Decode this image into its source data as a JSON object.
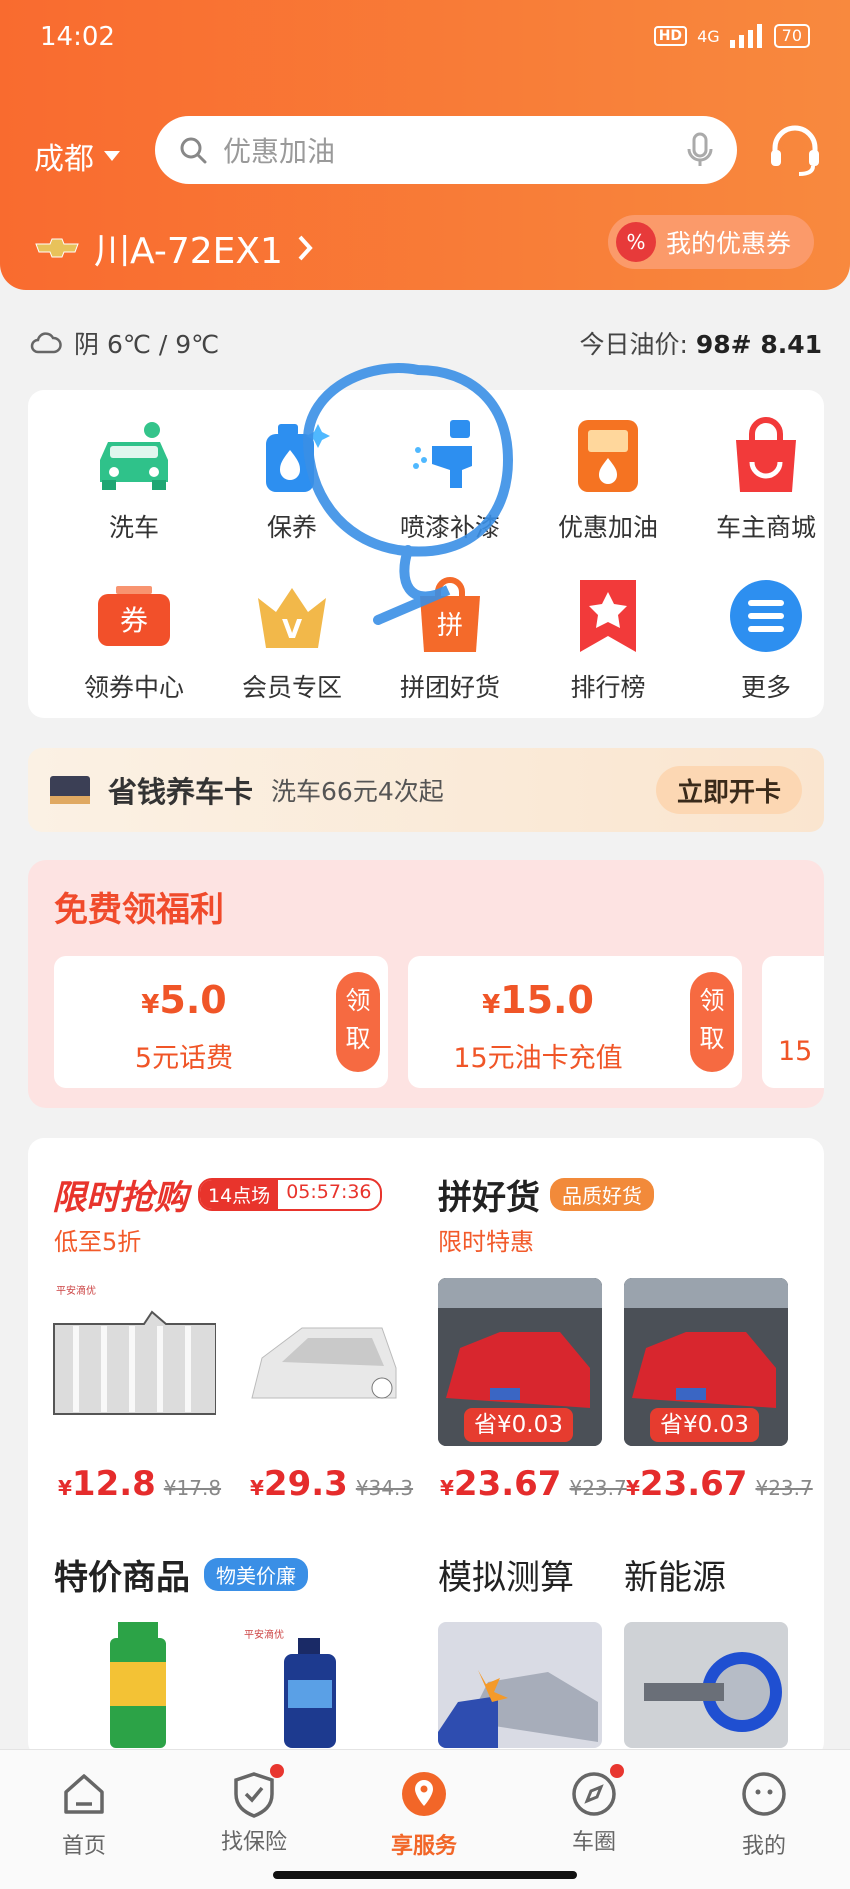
{
  "status_bar": {
    "time": "14:02",
    "network": "4G",
    "hd": "HD",
    "battery": "70"
  },
  "header": {
    "city": "成都",
    "search_placeholder": "优惠加油",
    "plate": "川A-72EX1",
    "coupon_label": "我的优惠券"
  },
  "weather": {
    "text": "阴 6℃ / 9℃",
    "oil_label": "今日油价:",
    "oil_value": "98# 8.41"
  },
  "services": [
    {
      "label": "洗车",
      "icon": "car-wash-icon"
    },
    {
      "label": "保养",
      "icon": "maintenance-icon"
    },
    {
      "label": "喷漆补漆",
      "icon": "spray-paint-icon"
    },
    {
      "label": "优惠加油",
      "icon": "fuel-icon"
    },
    {
      "label": "车主商城",
      "icon": "shopping-bag-icon"
    },
    {
      "label": "领券中心",
      "icon": "coupon-icon"
    },
    {
      "label": "会员专区",
      "icon": "crown-icon"
    },
    {
      "label": "拼团好货",
      "icon": "group-buy-icon"
    },
    {
      "label": "排行榜",
      "icon": "ranking-icon"
    },
    {
      "label": "更多",
      "icon": "more-icon"
    }
  ],
  "savings_card": {
    "title": "省钱养车卡",
    "desc": "洗车66元4次起",
    "button": "立即开卡"
  },
  "free_benefits": {
    "title": "免费领福利",
    "items": [
      {
        "currency": "¥",
        "amount": "5.0",
        "name": "5元话费",
        "get": "领取"
      },
      {
        "currency": "¥",
        "amount": "15.0",
        "name": "15元油卡充值",
        "get": "领取"
      },
      {
        "name": "15"
      }
    ]
  },
  "flash_sale": {
    "title": "限时抢购",
    "session": "14点场",
    "countdown": "05:57:36",
    "subtitle": "低至5折",
    "products": [
      {
        "currency": "¥",
        "price": "12.8",
        "original": "¥17.8",
        "brand": "平安滴优"
      },
      {
        "currency": "¥",
        "price": "29.3",
        "original": "¥34.3"
      }
    ]
  },
  "group_goods": {
    "title": "拼好货",
    "tag": "品质好货",
    "subtitle": "限时特惠",
    "products": [
      {
        "save": "省¥0.03",
        "currency": "¥",
        "price": "23.67",
        "original": "¥23.7"
      },
      {
        "save": "省¥0.03",
        "currency": "¥",
        "price": "23.67",
        "original": "¥23.7"
      }
    ]
  },
  "specials": {
    "title": "特价商品",
    "tag": "物美价廉",
    "brand": "平安滴优"
  },
  "simulate": {
    "title": "模拟测算"
  },
  "new_energy": {
    "title": "新能源"
  },
  "tabs": [
    {
      "label": "首页"
    },
    {
      "label": "找保险"
    },
    {
      "label": "享服务"
    },
    {
      "label": "车圈"
    },
    {
      "label": "我的"
    }
  ],
  "colors": {
    "accent": "#f96b2f",
    "price": "#e52c2c",
    "annotation": "#3a8fe6"
  }
}
